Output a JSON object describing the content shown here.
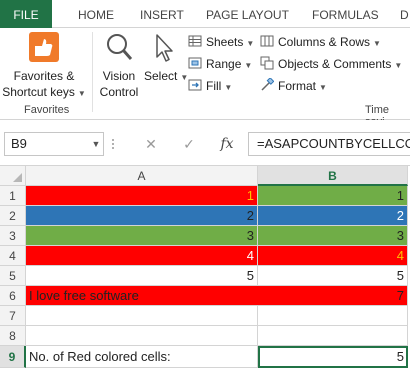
{
  "ribbon_tabs": {
    "file": "FILE",
    "home": "HOME",
    "insert": "INSERT",
    "page_layout": "PAGE LAYOUT",
    "formulas": "FORMULAS",
    "data": "D"
  },
  "ribbon": {
    "favorites_button": "Favorites &",
    "favorites_button2": "Shortcut keys",
    "favorites_group_label": "Favorites",
    "vision_control": "Vision",
    "vision_control2": "Control",
    "select": "Select",
    "sheets": "Sheets",
    "range": "Range",
    "fill": "Fill",
    "columns_rows": "Columns & Rows",
    "objects_comments": "Objects & Comments",
    "format": "Format",
    "time_saving_label": "Time savi"
  },
  "formula_bar": {
    "name_box": "B9",
    "fx": "fx",
    "formula": "=ASAPCOUNTBYCELLCOL"
  },
  "grid": {
    "col_a": "A",
    "col_b": "B",
    "rows": [
      {
        "num": "1",
        "a": "1",
        "b": "1"
      },
      {
        "num": "2",
        "a": "2",
        "b": "2"
      },
      {
        "num": "3",
        "a": "3",
        "b": "3"
      },
      {
        "num": "4",
        "a": "4",
        "b": "4"
      },
      {
        "num": "5",
        "a": "5",
        "b": "5"
      },
      {
        "num": "6",
        "a": "I love free software",
        "b": "7"
      },
      {
        "num": "7",
        "a": "",
        "b": ""
      },
      {
        "num": "8",
        "a": "",
        "b": ""
      },
      {
        "num": "9",
        "a": "No. of Red colored cells:",
        "b": "5"
      }
    ]
  },
  "colors": {
    "excel_green": "#217346",
    "red": "#ff0000",
    "blue": "#2e75b6",
    "green": "#70ad47",
    "orange_text": "#ffc000"
  }
}
